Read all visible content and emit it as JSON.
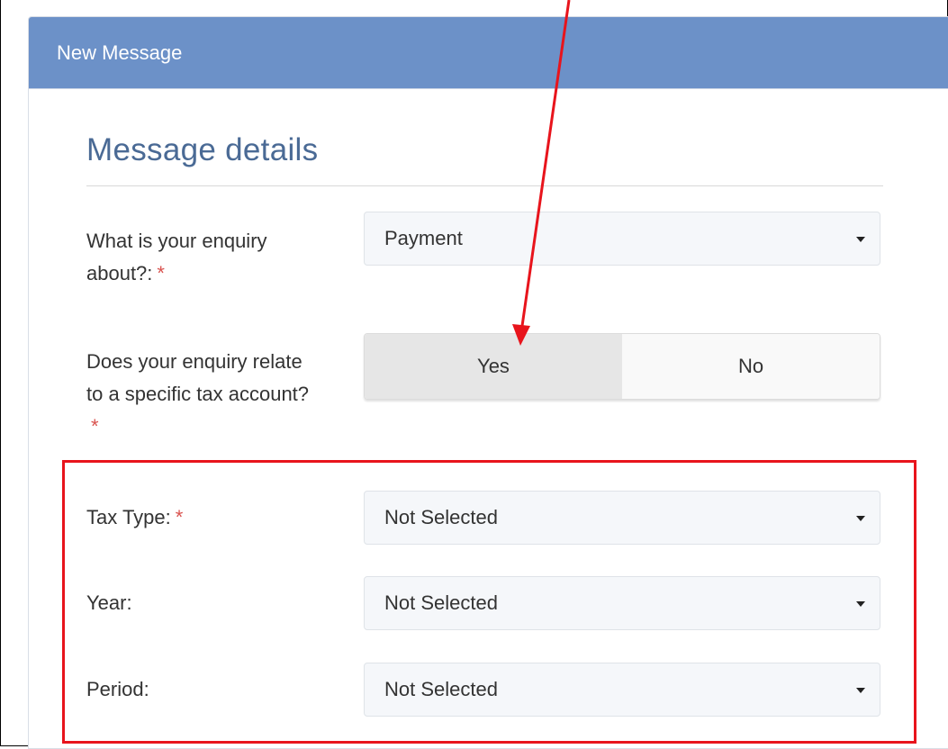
{
  "panel": {
    "header_title": "New Message",
    "section_title": "Message details"
  },
  "form": {
    "enquiry": {
      "label": "What is your enquiry about?:",
      "required_marker": "*",
      "value": "Payment"
    },
    "tax_account_question": {
      "label": "Does your enquiry relate to a specific tax account?",
      "required_marker": "*",
      "options": [
        "Yes",
        "No"
      ],
      "selected": "Yes"
    },
    "tax_type": {
      "label": "Tax Type:",
      "required_marker": "*",
      "value": "Not Selected"
    },
    "year": {
      "label": "Year:",
      "value": "Not Selected"
    },
    "period": {
      "label": "Period:",
      "value": "Not Selected"
    }
  },
  "annotations": {
    "arrow_color": "#e8141c",
    "box_color": "#e8141c"
  },
  "colors": {
    "header_bg": "#6c91c8",
    "title_color": "#4a6a95",
    "required": "#d9534f"
  }
}
